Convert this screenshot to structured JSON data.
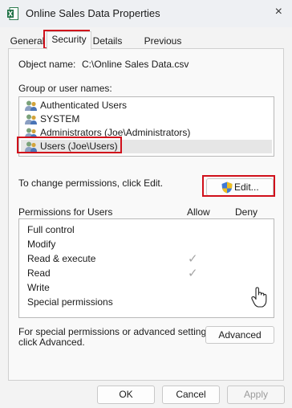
{
  "window": {
    "title": "Online Sales Data Properties",
    "icon": "excel-icon",
    "close_glyph": "×"
  },
  "tabs": [
    {
      "label": "General",
      "active": false
    },
    {
      "label": "Security",
      "active": true
    },
    {
      "label": "Details",
      "active": false
    },
    {
      "label": "Previous Versions",
      "active": false
    }
  ],
  "security": {
    "object_name_label": "Object name:",
    "object_name_value": "C:\\Online Sales Data.csv",
    "group_label": "Group or user names:",
    "users": [
      {
        "label": "Authenticated Users",
        "icon": "users-icon",
        "selected": false
      },
      {
        "label": "SYSTEM",
        "icon": "users-icon",
        "selected": false
      },
      {
        "label": "Administrators (Joe\\Administrators)",
        "icon": "users-icon",
        "selected": false
      },
      {
        "label": "Users (Joe\\Users)",
        "icon": "users-icon",
        "selected": true
      }
    ],
    "change_hint": "To change permissions, click Edit.",
    "edit_button": "Edit...",
    "permissions_label": "Permissions for Users",
    "allow_header": "Allow",
    "deny_header": "Deny",
    "permissions": [
      {
        "name": "Full control",
        "allow": false,
        "deny": false
      },
      {
        "name": "Modify",
        "allow": false,
        "deny": false
      },
      {
        "name": "Read & execute",
        "allow": true,
        "deny": false
      },
      {
        "name": "Read",
        "allow": true,
        "deny": false
      },
      {
        "name": "Write",
        "allow": false,
        "deny": false
      },
      {
        "name": "Special permissions",
        "allow": false,
        "deny": false
      }
    ],
    "check_glyph": "✓",
    "advanced_hint_line1": "For special permissions or advanced settings,",
    "advanced_hint_line2": "click Advanced.",
    "advanced_button": "Advanced"
  },
  "buttons": {
    "ok": "OK",
    "cancel": "Cancel",
    "apply": "Apply"
  },
  "highlight_color": "#d0101b"
}
